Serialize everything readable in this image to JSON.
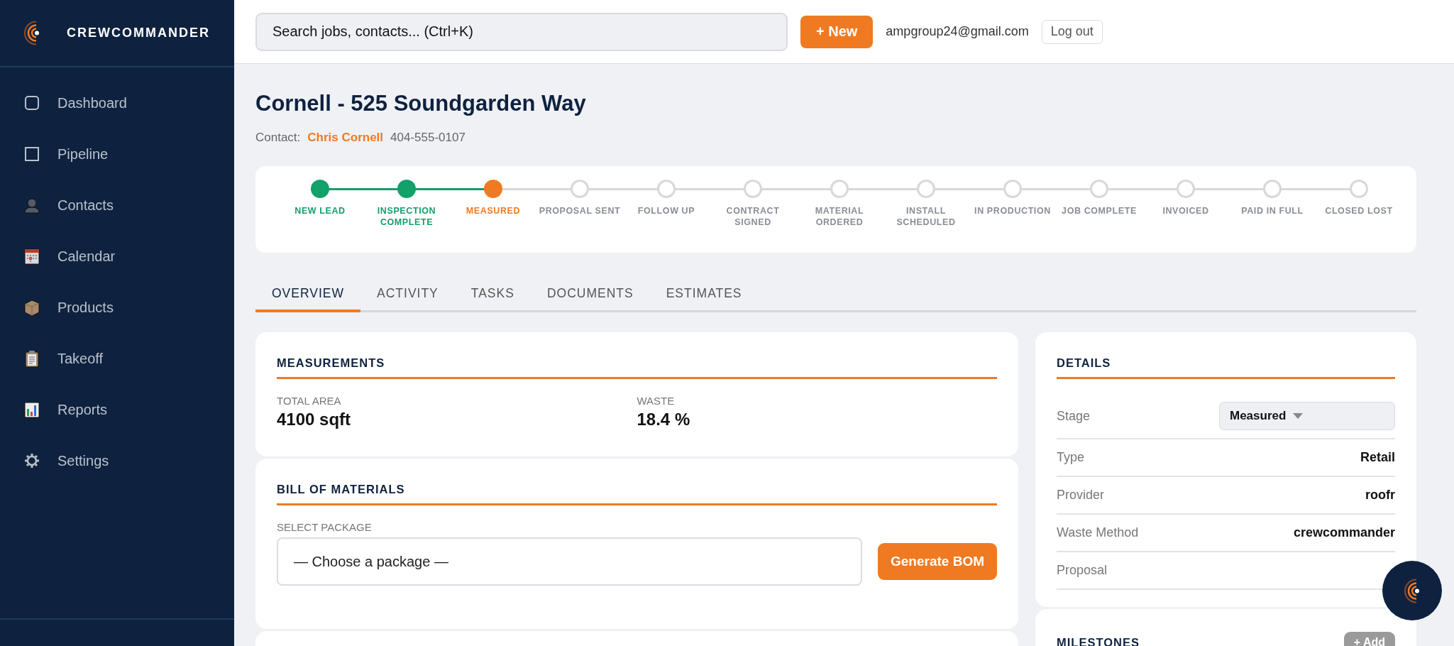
{
  "sidebar": {
    "brand": "CREWCOMMANDER",
    "items": [
      {
        "label": "Dashboard",
        "selected": false
      },
      {
        "label": "Pipeline",
        "selected": false
      },
      {
        "label": "Contacts",
        "selected": false
      },
      {
        "label": "Calendar",
        "selected": false
      },
      {
        "label": "Products",
        "selected": false
      },
      {
        "label": "Takeoff",
        "selected": false
      },
      {
        "label": "Reports",
        "selected": false
      },
      {
        "label": "Settings",
        "selected": false
      }
    ]
  },
  "header": {
    "search": {
      "placeholder": "Search jobs, contacts... (Ctrl+K)"
    },
    "new_button": "+ New",
    "user_email": "ampgroup24@gmail.com",
    "logout_button": "Log out"
  },
  "job": {
    "title": "Cornell - 525 Soundgarden Way",
    "contact_label": "Contact:",
    "contact_name": "Chris Cornell",
    "phone": "404-555-0107"
  },
  "stepper": {
    "steps": [
      {
        "label": "NEW LEAD",
        "done": true,
        "current": false
      },
      {
        "label": "INSPECTION COMPLETE",
        "done": true,
        "current": false
      },
      {
        "label": "MEASURED",
        "done": false,
        "current": true
      },
      {
        "label": "PROPOSAL SENT",
        "done": false,
        "current": false
      },
      {
        "label": "FOLLOW UP",
        "done": false,
        "current": false
      },
      {
        "label": "CONTRACT SIGNED",
        "done": false,
        "current": false
      },
      {
        "label": "MATERIAL ORDERED",
        "done": false,
        "current": false
      },
      {
        "label": "INSTALL SCHEDULED",
        "done": false,
        "current": false
      },
      {
        "label": "IN PRODUCTION",
        "done": false,
        "current": false
      },
      {
        "label": "JOB COMPLETE",
        "done": false,
        "current": false
      },
      {
        "label": "INVOICED",
        "done": false,
        "current": false
      },
      {
        "label": "PAID IN FULL",
        "done": false,
        "current": false
      },
      {
        "label": "CLOSED LOST",
        "done": false,
        "current": false
      }
    ]
  },
  "tabs": [
    {
      "label": "OVERVIEW",
      "selected": true
    },
    {
      "label": "ACTIVITY",
      "selected": false
    },
    {
      "label": "TASKS",
      "selected": false
    },
    {
      "label": "DOCUMENTS",
      "selected": false
    },
    {
      "label": "ESTIMATES",
      "selected": false
    }
  ],
  "measurements": {
    "title": "MEASUREMENTS",
    "fields": [
      {
        "label": "TOTAL AREA",
        "value": "4100 sqft"
      },
      {
        "label": "WASTE",
        "value": "18.4 %"
      }
    ]
  },
  "bill_of_materials": {
    "title": "BILL OF MATERIALS",
    "package_label": "SELECT PACKAGE",
    "package_value": "— Choose a package —",
    "generate_button": "Generate BOM"
  },
  "details": {
    "title": "DETAILS",
    "rows": [
      {
        "label": "Stage",
        "kind": "select",
        "value": "Measured"
      },
      {
        "label": "Type",
        "kind": "text",
        "value": "Retail"
      },
      {
        "label": "Provider",
        "kind": "text",
        "value": "roofr"
      },
      {
        "label": "Waste Method",
        "kind": "text",
        "value": "crewcommander"
      },
      {
        "label": "Proposal",
        "kind": "text"
      }
    ]
  },
  "milestones": {
    "title": "MILESTONES",
    "add_button": "+ Add"
  }
}
